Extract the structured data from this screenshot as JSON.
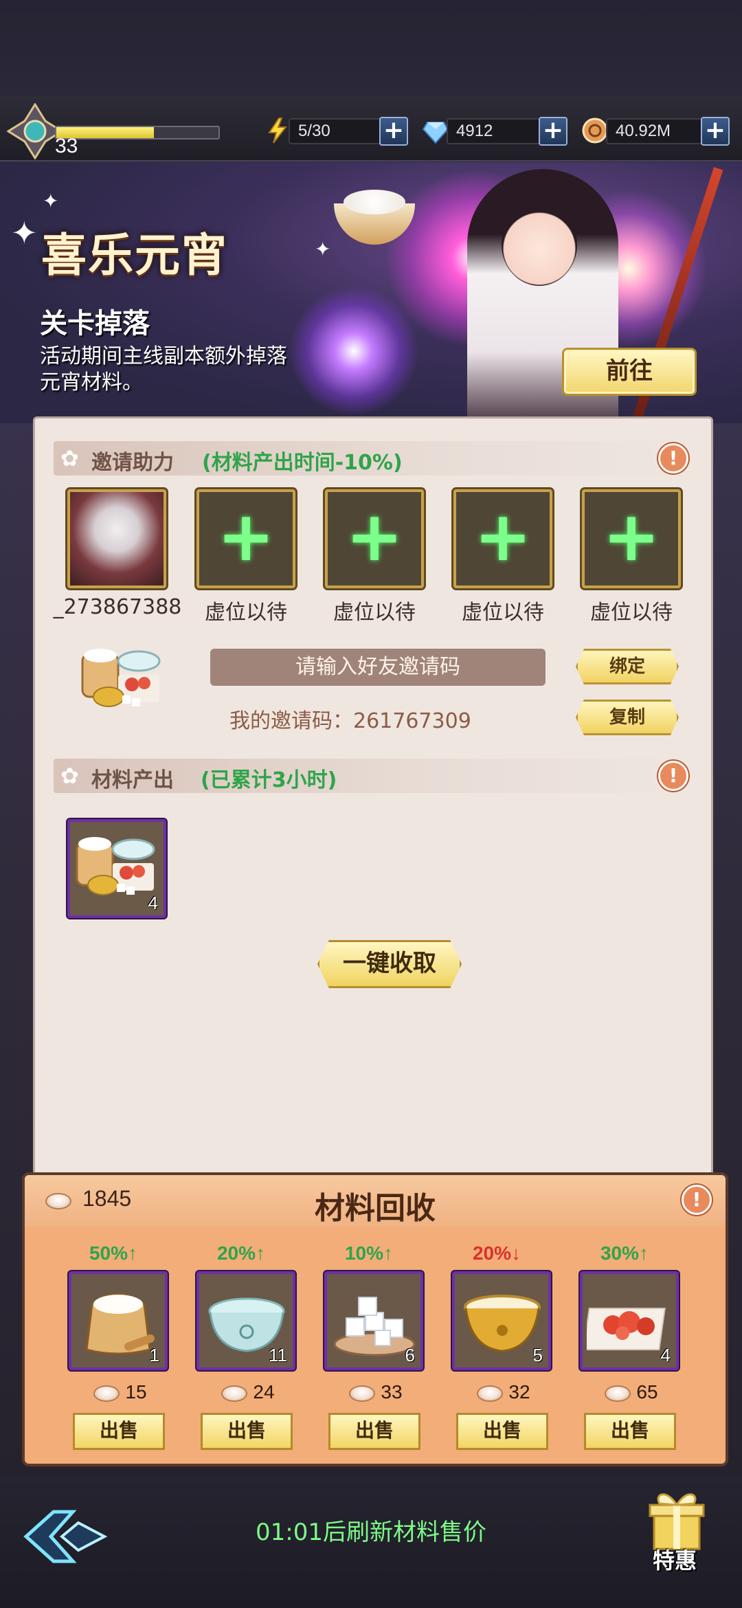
{
  "topbar": {
    "level": "33",
    "xp_fraction": 0.6,
    "stamina": "5/30",
    "gems": "4912",
    "coins": "40.92M"
  },
  "banner": {
    "title": "喜乐元宵",
    "subtitle": "关卡掉落",
    "description": "活动期间主线副本额外掉落元宵材料。",
    "goto_label": "前往"
  },
  "invite": {
    "heading": "邀请助力",
    "bonus": "(材料产出时间-10%)",
    "slots": [
      {
        "label": "_273867388",
        "filled": true
      },
      {
        "label": "虚位以待",
        "filled": false
      },
      {
        "label": "虚位以待",
        "filled": false
      },
      {
        "label": "虚位以待",
        "filled": false
      },
      {
        "label": "虚位以待",
        "filled": false
      }
    ],
    "input_placeholder": "请输入好友邀请码",
    "bind_label": "绑定",
    "copy_label": "复制",
    "my_code_text": "我的邀请码：261767309"
  },
  "output": {
    "heading": "材料产出",
    "accumulated": "(已累计3小时)",
    "item_count": "4",
    "collect_label": "一键收取"
  },
  "recycle": {
    "title": "材料回收",
    "currency_count": "1845",
    "items": [
      {
        "name": "flour-sack",
        "trend": "50%↑",
        "trend_color": "#2fa44a",
        "count": "1",
        "price": "15",
        "sell": "出售"
      },
      {
        "name": "water-bowl",
        "trend": "20%↑",
        "trend_color": "#2fa44a",
        "count": "11",
        "price": "24",
        "sell": "出售"
      },
      {
        "name": "sugar-cubes",
        "trend": "10%↑",
        "trend_color": "#2fa44a",
        "count": "6",
        "price": "33",
        "sell": "出售"
      },
      {
        "name": "golden-bowl",
        "trend": "20%↓",
        "trend_color": "#d8322e",
        "count": "5",
        "price": "32",
        "sell": "出售"
      },
      {
        "name": "red-filling",
        "trend": "30%↑",
        "trend_color": "#2fa44a",
        "count": "4",
        "price": "65",
        "sell": "出售"
      }
    ]
  },
  "footer": {
    "refresh_text": "01:01后刷新材料售价",
    "gift_label": "特惠"
  }
}
